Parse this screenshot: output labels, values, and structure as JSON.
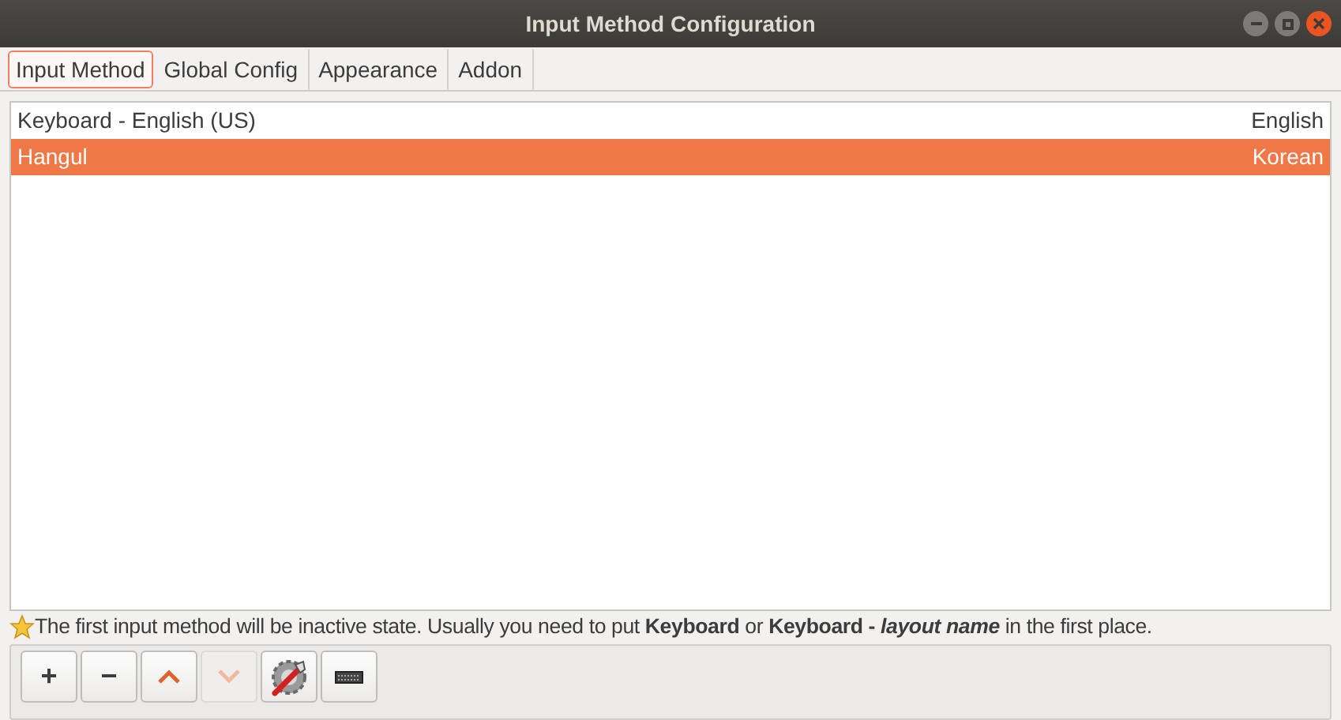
{
  "window": {
    "title": "Input Method Configuration"
  },
  "tabs": [
    {
      "label": "Input Method",
      "selected": true
    },
    {
      "label": "Global Config",
      "selected": false
    },
    {
      "label": "Appearance",
      "selected": false
    },
    {
      "label": "Addon",
      "selected": false
    }
  ],
  "input_methods": [
    {
      "name": "Keyboard - English (US)",
      "language": "English",
      "selected": false
    },
    {
      "name": "Hangul",
      "language": "Korean",
      "selected": true
    }
  ],
  "hint": [
    {
      "kind": "plain",
      "text": "The first input method will be inactive state. Usually you need to put "
    },
    {
      "kind": "bold",
      "text": "Keyboard"
    },
    {
      "kind": "plain",
      "text": " or "
    },
    {
      "kind": "bold",
      "text": "Keyboard - "
    },
    {
      "kind": "emphasis",
      "text": "layout name"
    },
    {
      "kind": "plain",
      "text": " in the first place."
    }
  ],
  "buttons": [
    {
      "kind": "add",
      "label": "+",
      "disabled": false
    },
    {
      "kind": "remove",
      "label": "−",
      "disabled": false
    },
    {
      "kind": "up",
      "disabled": false
    },
    {
      "kind": "down",
      "disabled": true
    },
    {
      "kind": "configure",
      "disabled": false
    },
    {
      "kind": "keyboard",
      "disabled": false
    }
  ]
}
